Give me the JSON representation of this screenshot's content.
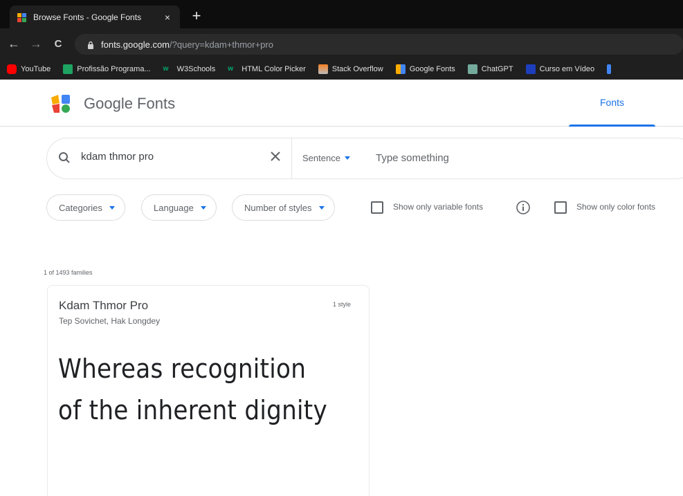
{
  "browser": {
    "tab": {
      "title": "Browse Fonts - Google Fonts",
      "close_glyph": "×"
    },
    "new_tab_glyph": "+",
    "nav": {
      "back": "←",
      "forward": "→",
      "reload": "C"
    },
    "url": {
      "host": "fonts.google.com",
      "path": "/?query=kdam+thmor+pro"
    },
    "bookmarks": [
      {
        "label": "YouTube",
        "icon": "youtube-icon",
        "color": "#ff0000"
      },
      {
        "label": "Profissão Programa...",
        "icon": "profissao-icon",
        "color": "#1ea362"
      },
      {
        "label": "W3Schools",
        "icon": "w3schools-icon",
        "color": "#04aa6d"
      },
      {
        "label": "HTML Color Picker",
        "icon": "w3schools-icon",
        "color": "#04aa6d"
      },
      {
        "label": "Stack Overflow",
        "icon": "stackoverflow-icon",
        "color": "#f48024"
      },
      {
        "label": "Google Fonts",
        "icon": "google-fonts-icon",
        "color": "#4285f4"
      },
      {
        "label": "ChatGPT",
        "icon": "chatgpt-icon",
        "color": "#74aa9c"
      },
      {
        "label": "Curso em Vídeo",
        "icon": "cursoemvideo-icon",
        "color": "#1d3fbb"
      }
    ]
  },
  "header": {
    "title": "Google Fonts",
    "nav_fonts": "Fonts",
    "accent": "#1a73e8"
  },
  "search": {
    "value": "kdam thmor pro",
    "sentence_label": "Sentence",
    "type_placeholder": "Type something"
  },
  "filters": {
    "categories": "Categories",
    "language": "Language",
    "number_of_styles": "Number of styles",
    "variable_label": "Show only variable fonts",
    "color_label": "Show only color fonts"
  },
  "results": {
    "count_text": "1 of 1493 families"
  },
  "card": {
    "name": "Kdam Thmor Pro",
    "designers": "Tep Sovichet, Hak Longdey",
    "styles": "1 style",
    "preview_line1": "Whereas recognition",
    "preview_line2": "of the inherent dignity"
  }
}
